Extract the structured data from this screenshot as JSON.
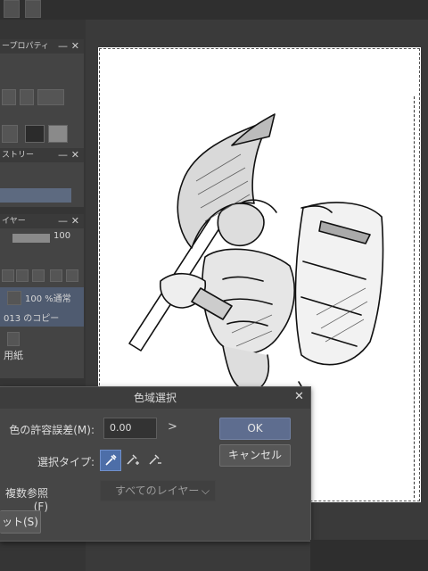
{
  "left_panel": {
    "layer_property_title": "ープロパティ",
    "history_title": "ストリー",
    "layer_title": "イヤー",
    "opacity_value": "100",
    "layer_item_opacity": "100 %通常",
    "layer_item_name": "013 のコピー",
    "paper_label": "用紙"
  },
  "dialog": {
    "title": "色域選択",
    "tolerance_label": "色の許容誤差(M):",
    "tolerance_value": "0.00",
    "arrow": ">",
    "selection_type_label": "選択タイプ:",
    "multi_ref_label": "複数参照(F)",
    "layer_option": "すべてのレイヤー",
    "reset_label": "ット(S)",
    "ok_label": "OK",
    "cancel_label": "キャンセル",
    "close_glyph": "✕"
  },
  "icons": [
    "eyedropper-icon",
    "eyedropper-plus-icon",
    "eyedropper-minus-icon",
    "close-icon",
    "minus-icon",
    "chevron-down-icon"
  ],
  "colors": {
    "accent": "#5e6d8f",
    "selected_tool": "#4d6ea8",
    "canvas": "#ffffff"
  }
}
